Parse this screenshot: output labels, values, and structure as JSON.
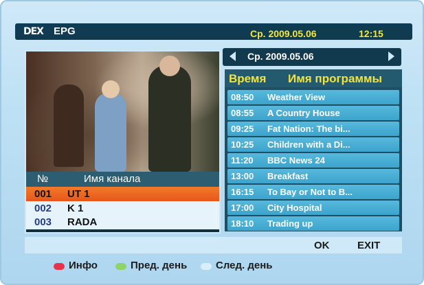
{
  "header": {
    "logo": "DEX",
    "title": "EPG",
    "date": "Ср. 2009.05.06",
    "time": "12:15"
  },
  "channel_panel": {
    "col_number": "№",
    "col_name": "Имя канала",
    "channels": [
      {
        "number": "001",
        "name": "UT 1",
        "selected": true
      },
      {
        "number": "002",
        "name": "K 1",
        "selected": false
      },
      {
        "number": "003",
        "name": "RADA",
        "selected": false
      }
    ]
  },
  "date_nav": {
    "date": "Ср. 2009.05.06",
    "left_icon": "arrow-left-icon",
    "right_icon": "arrow-right-icon"
  },
  "epg": {
    "col_time": "Время",
    "col_program": "Имя программы",
    "programs": [
      {
        "time": "08:50",
        "title": "Weather View"
      },
      {
        "time": "08:55",
        "title": "A Country House"
      },
      {
        "time": "09:25",
        "title": "Fat Nation: The bi..."
      },
      {
        "time": "10:25",
        "title": "Children with a Di..."
      },
      {
        "time": "11:20",
        "title": "BBC News 24"
      },
      {
        "time": "13:00",
        "title": "Breakfast"
      },
      {
        "time": "16:15",
        "title": "To Bay or  Not to B..."
      },
      {
        "time": "17:00",
        "title": "City Hospital"
      },
      {
        "time": "18:10",
        "title": "Trading up"
      }
    ]
  },
  "buttons": {
    "ok": "OK",
    "exit": "EXIT"
  },
  "legend": [
    {
      "color": "#e8324a",
      "label": "Инфо"
    },
    {
      "color": "#8fd36a",
      "label": "Пред. день"
    },
    {
      "color": "#d8eef9",
      "label": "След. день"
    }
  ]
}
